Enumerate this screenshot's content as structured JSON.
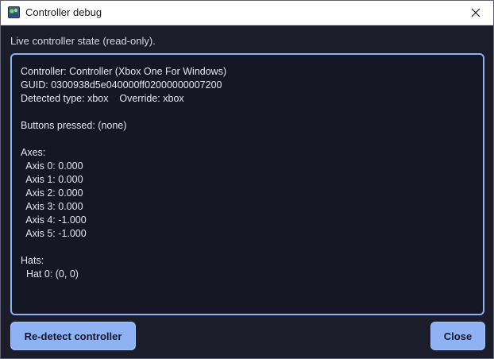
{
  "window": {
    "title": "Controller debug"
  },
  "subtitle": "Live controller state (read-only).",
  "state_lines": [
    "Controller: Controller (Xbox One For Windows)",
    "GUID: 0300938d5e040000ff02000000007200",
    "Detected type: xbox    Override: xbox",
    "",
    "Buttons pressed: (none)",
    "",
    "Axes:",
    "  Axis 0: 0.000",
    "  Axis 1: 0.000",
    "  Axis 2: 0.000",
    "  Axis 3: 0.000",
    "  Axis 4: -1.000",
    "  Axis 5: -1.000",
    "",
    "Hats:",
    "  Hat 0: (0, 0)"
  ],
  "buttons": {
    "redetect_label": "Re-detect controller",
    "close_label": "Close"
  },
  "icons": {
    "app": "app-icon",
    "close": "close-icon"
  },
  "colors": {
    "background": "#1b1d2b",
    "panel": "#151724",
    "accent": "#8fb2f4",
    "text": "#e3e6f2"
  }
}
